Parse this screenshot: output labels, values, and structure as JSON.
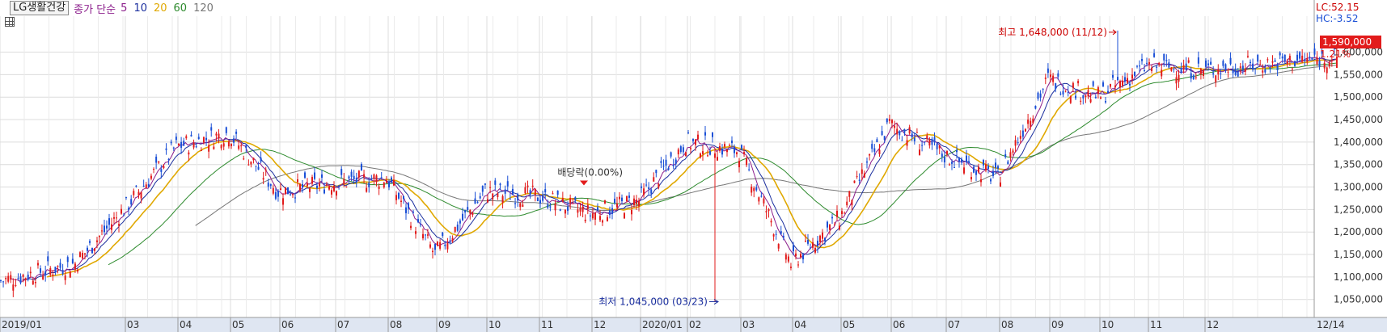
{
  "header": {
    "stock_name": "LG생활건강",
    "ma_type": "종가 단순",
    "ma_periods": [
      {
        "label": "5",
        "color": "#8b1d8b"
      },
      {
        "label": "10",
        "color": "#1a2e9e"
      },
      {
        "label": "20",
        "color": "#e0a800"
      },
      {
        "label": "60",
        "color": "#2e8b2e"
      },
      {
        "label": "120",
        "color": "#777777"
      }
    ]
  },
  "corner": {
    "lc": "LC:52.15",
    "hc": "HC:-3.52"
  },
  "current": {
    "price": "1,590,000",
    "change": "1.21%"
  },
  "annotations": {
    "high": "최고 1,648,000 (11/12)",
    "low": "최저 1,045,000 (03/23)",
    "dividend": "배당락(0.00%)"
  },
  "colors": {
    "up": "#e21b1b",
    "down": "#1a4fd6",
    "grid": "#dcdcdc",
    "axis_bg": "#dfe6f2"
  },
  "chart_data": {
    "type": "candlestick",
    "ylim": [
      1010000,
      1680000
    ],
    "y_ticks": [
      "1,600,000",
      "1,550,000",
      "1,500,000",
      "1,450,000",
      "1,400,000",
      "1,350,000",
      "1,300,000",
      "1,250,000",
      "1,200,000",
      "1,150,000",
      "1,100,000",
      "1,050,000"
    ],
    "y_tick_values": [
      1600000,
      1550000,
      1500000,
      1450000,
      1400000,
      1350000,
      1300000,
      1250000,
      1200000,
      1150000,
      1100000,
      1050000
    ],
    "x_ticks": [
      {
        "label": "2019/01",
        "month": 0
      },
      {
        "label": "03",
        "month": 2
      },
      {
        "label": "04",
        "month": 3
      },
      {
        "label": "05",
        "month": 4
      },
      {
        "label": "06",
        "month": 5
      },
      {
        "label": "07",
        "month": 6
      },
      {
        "label": "08",
        "month": 7
      },
      {
        "label": "09",
        "month": 8
      },
      {
        "label": "10",
        "month": 9
      },
      {
        "label": "11",
        "month": 10
      },
      {
        "label": "12",
        "month": 11
      },
      {
        "label": "2020/01",
        "month": 12
      },
      {
        "label": "02",
        "month": 13
      },
      {
        "label": "03",
        "month": 14
      },
      {
        "label": "04",
        "month": 15
      },
      {
        "label": "05",
        "month": 16
      },
      {
        "label": "06",
        "month": 17
      },
      {
        "label": "07",
        "month": 18
      },
      {
        "label": "08",
        "month": 19
      },
      {
        "label": "09",
        "month": 20
      },
      {
        "label": "10",
        "month": 21
      },
      {
        "label": "11",
        "month": 22
      },
      {
        "label": "12",
        "month": 23
      }
    ],
    "end_label": "12/14",
    "monthly_close": [
      {
        "month": "2019/01",
        "close": 1130000
      },
      {
        "month": "2019/02",
        "close": 1250000
      },
      {
        "month": "2019/03",
        "close": 1390000
      },
      {
        "month": "2019/04",
        "close": 1420000
      },
      {
        "month": "2019/05",
        "close": 1290000
      },
      {
        "month": "2019/06",
        "close": 1310000
      },
      {
        "month": "2019/07",
        "close": 1320000
      },
      {
        "month": "2019/08",
        "close": 1150000
      },
      {
        "month": "2019/09",
        "close": 1290000
      },
      {
        "month": "2019/10",
        "close": 1280000
      },
      {
        "month": "2019/11",
        "close": 1240000
      },
      {
        "month": "2019/12",
        "close": 1270000
      },
      {
        "month": "2020/01",
        "close": 1400000
      },
      {
        "month": "2020/02",
        "close": 1380000
      },
      {
        "month": "2020/03",
        "close": 1130000
      },
      {
        "month": "2020/04",
        "close": 1230000
      },
      {
        "month": "2020/05",
        "close": 1440000
      },
      {
        "month": "2020/06",
        "close": 1370000
      },
      {
        "month": "2020/07",
        "close": 1320000
      },
      {
        "month": "2020/08",
        "close": 1540000
      },
      {
        "month": "2020/09",
        "close": 1500000
      },
      {
        "month": "2020/10",
        "close": 1570000
      },
      {
        "month": "2020/11",
        "close": 1560000
      },
      {
        "month": "2020/12",
        "close": 1590000
      }
    ],
    "high": {
      "value": 1648000,
      "date": "2020/11/12"
    },
    "low": {
      "value": 1045000,
      "date": "2020/03/23"
    },
    "last_close": 1590000
  }
}
